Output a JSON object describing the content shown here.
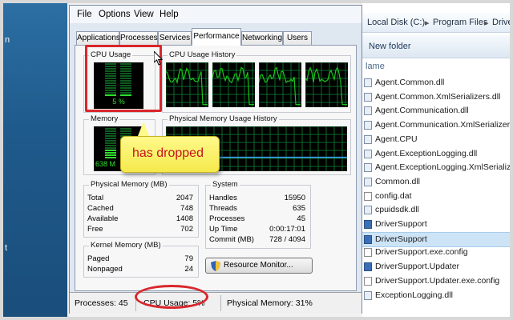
{
  "desktop": {
    "mark1": "n",
    "mark2": "t"
  },
  "explorer": {
    "address_parts": [
      "Local Disk (C:)",
      "▸",
      "Program Files",
      "▸",
      "Drive"
    ],
    "new_folder_label": "New folder",
    "column_header": "lame",
    "files": [
      {
        "name": "Agent.Common.dll",
        "type": "dll"
      },
      {
        "name": "Agent.Common.XmlSerializers.dll",
        "type": "dll"
      },
      {
        "name": "Agent.Communication.dll",
        "type": "dll"
      },
      {
        "name": "Agent.Communication.XmlSerializers.d",
        "type": "dll"
      },
      {
        "name": "Agent.CPU",
        "type": "dll"
      },
      {
        "name": "Agent.ExceptionLogging.dll",
        "type": "dll"
      },
      {
        "name": "Agent.ExceptionLogging.XmlSerializers.",
        "type": "dll"
      },
      {
        "name": "Common.dll",
        "type": "dll"
      },
      {
        "name": "config.dat",
        "type": "cfg"
      },
      {
        "name": "cpuidsdk.dll",
        "type": "dll"
      },
      {
        "name": "DriverSupport",
        "type": "exe"
      },
      {
        "name": "DriverSupport",
        "type": "exe",
        "selected": true
      },
      {
        "name": "DriverSupport.exe.config",
        "type": "cfg"
      },
      {
        "name": "DriverSupport.Updater",
        "type": "exe"
      },
      {
        "name": "DriverSupport.Updater.exe.config",
        "type": "cfg"
      },
      {
        "name": "ExceptionLogging.dll",
        "type": "dll"
      }
    ]
  },
  "taskmanager": {
    "menu": [
      "File",
      "Options",
      "View",
      "Help"
    ],
    "tabs": [
      "Applications",
      "Processes",
      "Services",
      "Performance",
      "Networking",
      "Users"
    ],
    "active_tab": "Performance",
    "cpu_usage": {
      "title": "CPU Usage",
      "value_label": "5 %",
      "level": 0.05
    },
    "cpu_history": {
      "title": "CPU Usage History",
      "cores": 4
    },
    "memory": {
      "title": "Memory",
      "value_label": "638 M",
      "level": 0.31
    },
    "mem_history": {
      "title": "Physical Memory Usage History",
      "level": 0.31
    },
    "physical_memory": {
      "title": "Physical Memory (MB)",
      "rows": [
        {
          "k": "Total",
          "v": "2047"
        },
        {
          "k": "Cached",
          "v": "748"
        },
        {
          "k": "Available",
          "v": "1408"
        },
        {
          "k": "Free",
          "v": "702"
        }
      ]
    },
    "system": {
      "title": "System",
      "rows": [
        {
          "k": "Handles",
          "v": "15950"
        },
        {
          "k": "Threads",
          "v": "635"
        },
        {
          "k": "Processes",
          "v": "45"
        },
        {
          "k": "Up Time",
          "v": "0:00:17:01"
        },
        {
          "k": "Commit (MB)",
          "v": "728 / 4094"
        }
      ]
    },
    "kernel_memory": {
      "title": "Kernel Memory (MB)",
      "rows": [
        {
          "k": "Paged",
          "v": "79"
        },
        {
          "k": "Nonpaged",
          "v": "24"
        }
      ]
    },
    "resource_monitor_label": "Resource Monitor...",
    "status": {
      "processes": "Processes: 45",
      "cpu": "CPU Usage: 5%",
      "memory": "Physical Memory: 31%"
    }
  },
  "annotation": {
    "callout_text": "has dropped",
    "color": "#d9262b"
  },
  "colors": {
    "graph_green": "#16c616",
    "graph_grid": "#0c6a2a",
    "mem_line": "#3fa6ff"
  }
}
